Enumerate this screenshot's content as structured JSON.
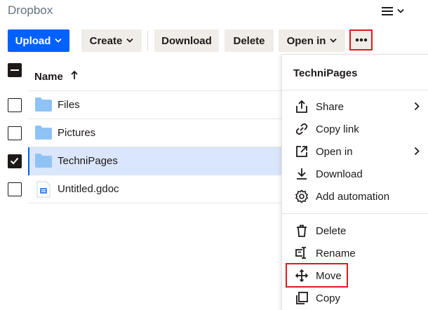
{
  "app": {
    "title": "Dropbox"
  },
  "toolbar": {
    "upload_label": "Upload",
    "create_label": "Create",
    "download_label": "Download",
    "delete_label": "Delete",
    "open_in_label": "Open in",
    "more_label": "•••"
  },
  "table": {
    "name_header": "Name",
    "rows": [
      {
        "name": "Files",
        "type": "folder",
        "checked": false
      },
      {
        "name": "Pictures",
        "type": "folder",
        "checked": false
      },
      {
        "name": "TechniPages",
        "type": "folder",
        "checked": true
      },
      {
        "name": "Untitled.gdoc",
        "type": "gdoc",
        "checked": false
      }
    ]
  },
  "context_menu": {
    "title": "TechniPages",
    "items": [
      {
        "label": "Share",
        "icon": "share-icon",
        "submenu": true
      },
      {
        "label": "Copy link",
        "icon": "link-icon",
        "submenu": false
      },
      {
        "label": "Open in",
        "icon": "open-external-icon",
        "submenu": true
      },
      {
        "label": "Download",
        "icon": "download-icon",
        "submenu": false
      },
      {
        "label": "Add automation",
        "icon": "gear-icon",
        "submenu": false
      },
      {
        "label": "Delete",
        "icon": "trash-icon",
        "submenu": false
      },
      {
        "label": "Rename",
        "icon": "rename-icon",
        "submenu": false
      },
      {
        "label": "Move",
        "icon": "move-icon",
        "submenu": false,
        "highlighted": true
      },
      {
        "label": "Copy",
        "icon": "copy-icon",
        "submenu": false
      }
    ]
  },
  "colors": {
    "accent": "#0061fe",
    "highlight": "#e0191f",
    "selected_row": "#d9e6fb",
    "folder": "#90c3f5"
  }
}
